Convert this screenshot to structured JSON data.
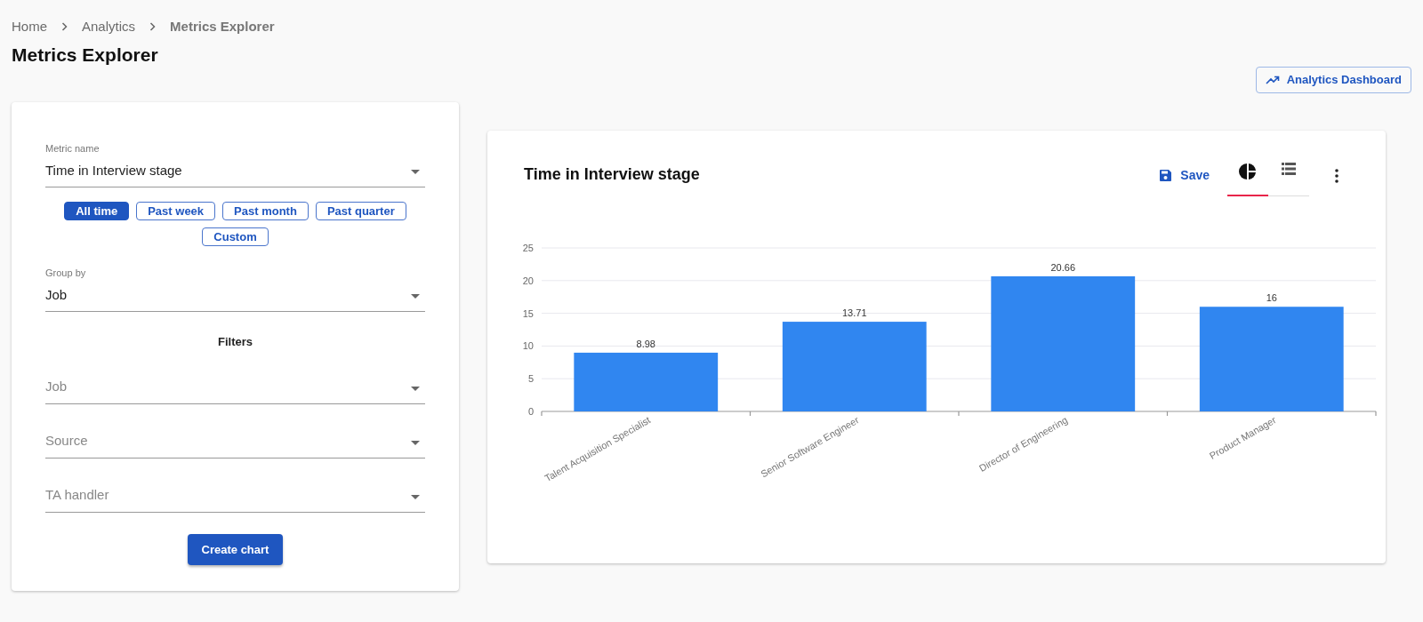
{
  "breadcrumbs": [
    {
      "label": "Home",
      "current": false
    },
    {
      "label": "Analytics",
      "current": false
    },
    {
      "label": "Metrics Explorer",
      "current": true
    }
  ],
  "page_title": "Metrics Explorer",
  "header_button": "Analytics Dashboard",
  "form": {
    "metric": {
      "label": "Metric name",
      "value": "Time in Interview stage"
    },
    "periods": [
      {
        "label": "All time",
        "selected": true
      },
      {
        "label": "Past week",
        "selected": false
      },
      {
        "label": "Past month",
        "selected": false
      },
      {
        "label": "Past quarter",
        "selected": false
      },
      {
        "label": "Custom",
        "selected": false
      }
    ],
    "group_by": {
      "label": "Group by",
      "value": "Job"
    },
    "filters_heading": "Filters",
    "filters": [
      {
        "placeholder": "Job"
      },
      {
        "placeholder": "Source"
      },
      {
        "placeholder": "TA handler"
      }
    ],
    "submit": "Create chart"
  },
  "chart_card": {
    "title": "Time in Interview stage",
    "save_label": "Save",
    "view_tabs": [
      {
        "kind": "chart",
        "selected": true
      },
      {
        "kind": "table",
        "selected": false
      }
    ],
    "chart_data": {
      "type": "bar",
      "categories": [
        "Talent Acquisition Specialist",
        "Senior Software Engineer",
        "Director of Engineering",
        "Product Manager"
      ],
      "series": [
        {
          "color": "#3086f0",
          "values": [
            8.98,
            13.71,
            20.66,
            16
          ]
        }
      ],
      "ylim": [
        0,
        25
      ],
      "yticks": [
        0,
        5,
        10,
        15,
        20,
        25
      ],
      "grid": true,
      "data_labels": true
    }
  }
}
